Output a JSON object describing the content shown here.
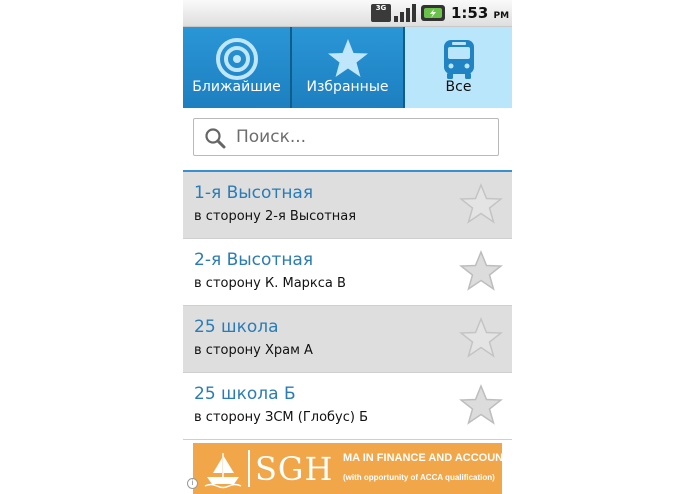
{
  "status_bar": {
    "network": "3G",
    "time": "1:53",
    "ampm": "PM"
  },
  "tabs": [
    {
      "label": "Ближайшие",
      "icon": "target-icon",
      "selected": false
    },
    {
      "label": "Избранные",
      "icon": "star-icon",
      "selected": false
    },
    {
      "label": "Все",
      "icon": "bus-icon",
      "selected": true
    }
  ],
  "search": {
    "placeholder": "Поиск...",
    "value": ""
  },
  "stops": [
    {
      "name": "1-я Высотная",
      "direction": "в сторону 2-я Высотная",
      "favorite": false
    },
    {
      "name": "2-я Высотная",
      "direction": "в сторону К. Маркса В",
      "favorite": false
    },
    {
      "name": "25 школа",
      "direction": "в сторону Храм А",
      "favorite": false
    },
    {
      "name": "25 школа Б",
      "direction": "в сторону ЗСМ (Глобус) Б",
      "favorite": false
    }
  ],
  "ad": {
    "brand": "SGH",
    "headline": "MA IN FINANCE AND ACCOUNTING",
    "subline": "(with opportunity of ACCA qualification)",
    "background_color": "#f2a64a"
  },
  "colors": {
    "tab_blue": "#1d7fc0",
    "tab_selected": "#b9e6fb",
    "link_blue": "#2a7cb6",
    "row_shade": "#dedede"
  }
}
